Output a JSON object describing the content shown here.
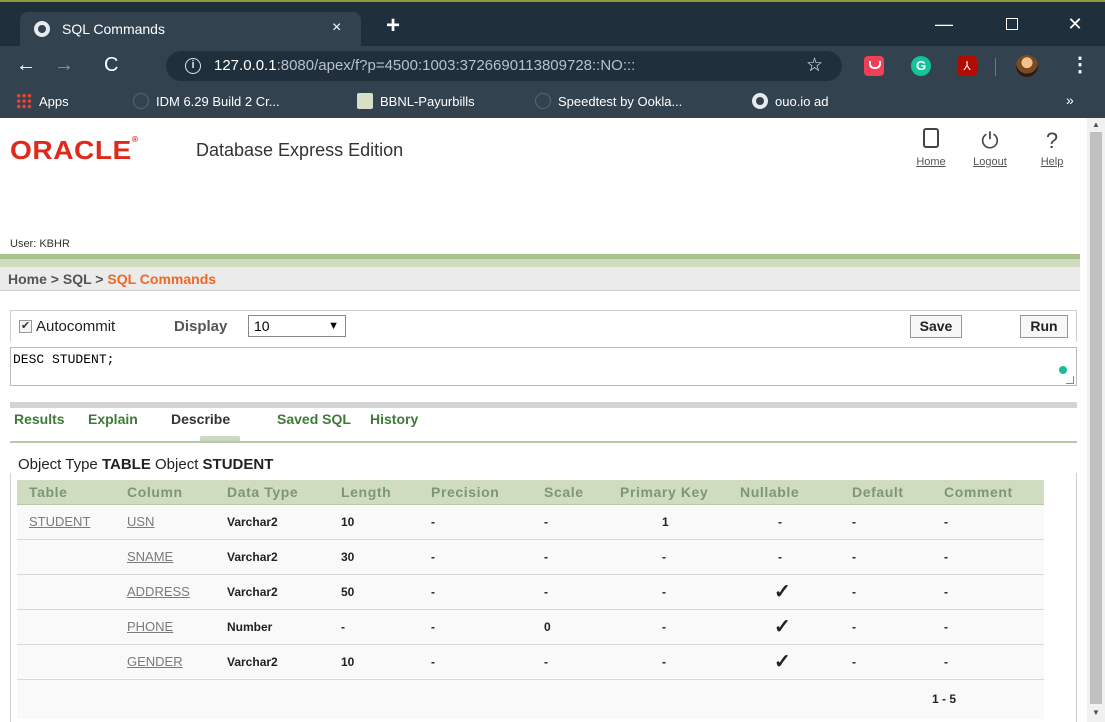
{
  "browser": {
    "tab_title": "SQL Commands",
    "tab_close": "×",
    "new_tab": "+",
    "window_controls": {
      "minimize": "—",
      "maximize": "",
      "close": "✕"
    },
    "nav": {
      "back": "←",
      "forward": "→",
      "reload": "C"
    },
    "url_host": "127.0.0.1",
    "url_rest": ":8080/apex/f?p=4500:1003:3726690113809728::NO:::",
    "info_icon": "i",
    "star": "☆",
    "extensions": {
      "grammarly": "G",
      "pdf": "⅄"
    },
    "menu": "⋮",
    "bookmarks": [
      {
        "label": "Apps",
        "icon": "apps-grid-icon"
      },
      {
        "label": "IDM 6.29 Build 2 Cr...",
        "icon": "globe-icon"
      },
      {
        "label": "BBNL-Payurbills",
        "icon": "bbnl-icon"
      },
      {
        "label": "Speedtest by Ookla...",
        "icon": "globe-icon"
      },
      {
        "label": "ouo.io ad",
        "icon": "globe-icon"
      }
    ],
    "bookmarks_more": "»"
  },
  "header": {
    "logo": "ORACLE",
    "logo_mark": "®",
    "product": "Database Express Edition",
    "links": {
      "home": "Home",
      "logout": "Logout",
      "help": "Help"
    },
    "help_glyph": "?",
    "logout_glyph": "⏻",
    "user": "User: KBHR"
  },
  "breadcrumb": {
    "home": "Home",
    "sep1": " > ",
    "sql": "SQL",
    "sep2": " > ",
    "current": "SQL Commands"
  },
  "command_bar": {
    "autocommit_label": "Autocommit",
    "autocommit_checked": "✔",
    "display_label": "Display",
    "display_value": "10",
    "select_caret": "▼",
    "save_label": "Save",
    "run_label": "Run"
  },
  "sql_text": "DESC STUDENT;",
  "result_tabs": [
    "Results",
    "Explain",
    "Describe",
    "Saved SQL",
    "History"
  ],
  "active_tab": "Describe",
  "object_info": {
    "type_label": "Object Type",
    "type_value": "TABLE",
    "object_label": "Object",
    "object_value": "STUDENT"
  },
  "describe_table": {
    "columns": [
      "Table",
      "Column",
      "Data Type",
      "Length",
      "Precision",
      "Scale",
      "Primary Key",
      "Nullable",
      "Default",
      "Comment"
    ],
    "rows": [
      {
        "table": "STUDENT",
        "column": "USN",
        "data_type": "Varchar2",
        "length": "10",
        "precision": "-",
        "scale": "-",
        "primary_key": "1",
        "nullable": "-",
        "default": "-",
        "comment": "-"
      },
      {
        "table": "",
        "column": "SNAME",
        "data_type": "Varchar2",
        "length": "30",
        "precision": "-",
        "scale": "-",
        "primary_key": "-",
        "nullable": "-",
        "default": "-",
        "comment": "-"
      },
      {
        "table": "",
        "column": "ADDRESS",
        "data_type": "Varchar2",
        "length": "50",
        "precision": "-",
        "scale": "-",
        "primary_key": "-",
        "nullable": "✓",
        "default": "-",
        "comment": "-"
      },
      {
        "table": "",
        "column": "PHONE",
        "data_type": "Number",
        "length": "-",
        "precision": "-",
        "scale": "0",
        "primary_key": "-",
        "nullable": "✓",
        "default": "-",
        "comment": "-"
      },
      {
        "table": "",
        "column": "GENDER",
        "data_type": "Varchar2",
        "length": "10",
        "precision": "-",
        "scale": "-",
        "primary_key": "-",
        "nullable": "✓",
        "default": "-",
        "comment": "-"
      }
    ],
    "pagination": "1 - 5"
  },
  "colors": {
    "oracle_red": "#e0281b",
    "breadcrumb_current": "#f26722",
    "tab_green": "#3f7a38",
    "header_green": "#cfdcc0"
  }
}
